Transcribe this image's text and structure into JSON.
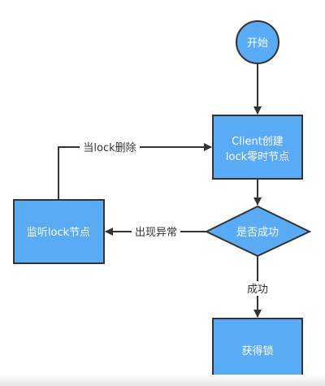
{
  "nodes": {
    "start": "开始",
    "create": {
      "line1": "Client创建",
      "line2": "lock零时节点"
    },
    "decision": "是否成功",
    "watch": "监听lock节点",
    "acquire": "获得锁"
  },
  "edges": {
    "on_delete": "当lock删除",
    "on_error": "出现异常",
    "on_success": "成功"
  },
  "colors": {
    "node_fill": "#5aabf5",
    "stroke": "#333333"
  }
}
